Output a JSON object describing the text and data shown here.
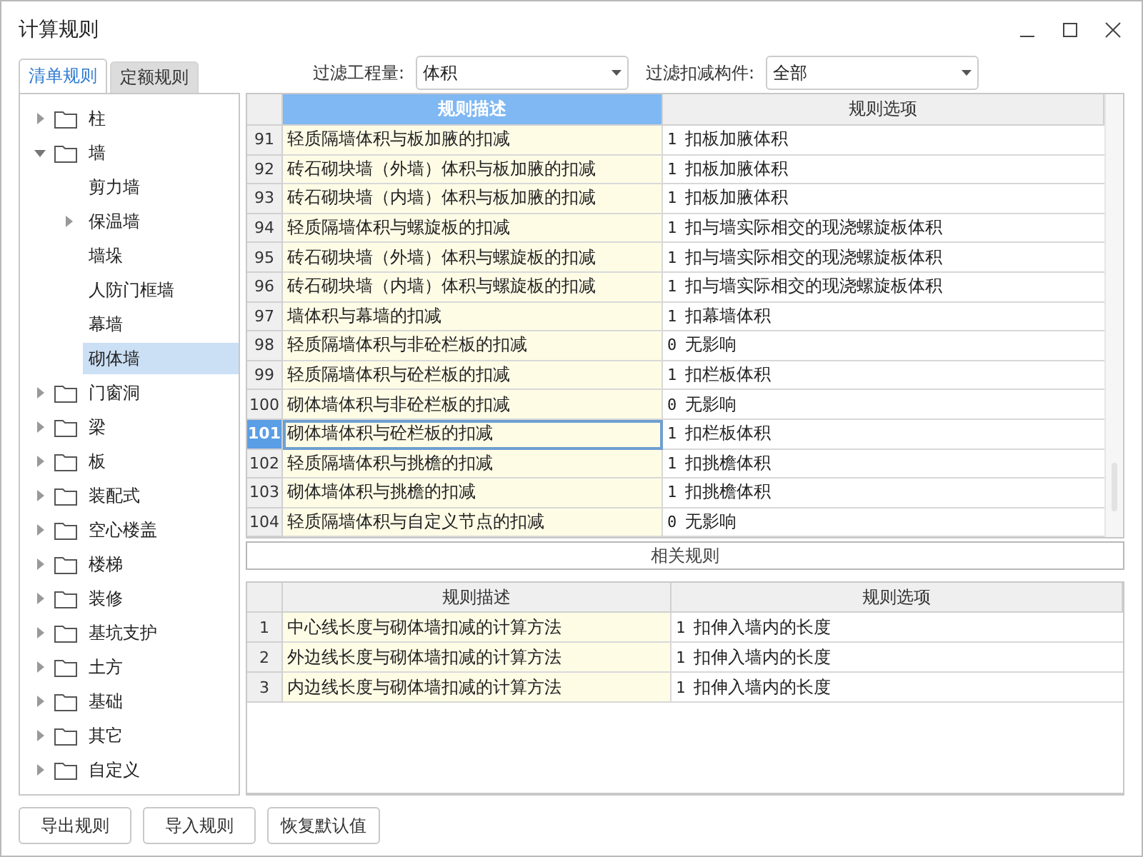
{
  "window": {
    "title": "计算规则"
  },
  "tabs": [
    {
      "label": "清单规则",
      "selected": true
    },
    {
      "label": "定额规则",
      "selected": false
    }
  ],
  "filters": [
    {
      "label": "过滤工程量:",
      "value": "体积"
    },
    {
      "label": "过滤扣减构件:",
      "value": "全部"
    }
  ],
  "tree": [
    {
      "label": "柱",
      "kind": "folder",
      "expanded": false
    },
    {
      "label": "墙",
      "kind": "folder",
      "expanded": true,
      "children": [
        {
          "label": "剪力墙",
          "selected": false
        },
        {
          "label": "保温墙",
          "expanded": false,
          "selected": false
        },
        {
          "label": "墙垛",
          "selected": false
        },
        {
          "label": "人防门框墙",
          "selected": false
        },
        {
          "label": "幕墙",
          "selected": false
        },
        {
          "label": "砌体墙",
          "selected": true
        }
      ]
    },
    {
      "label": "门窗洞",
      "kind": "folder",
      "expanded": false
    },
    {
      "label": "梁",
      "kind": "folder",
      "expanded": false
    },
    {
      "label": "板",
      "kind": "folder",
      "expanded": false
    },
    {
      "label": "装配式",
      "kind": "folder",
      "expanded": false
    },
    {
      "label": "空心楼盖",
      "kind": "folder",
      "expanded": false
    },
    {
      "label": "楼梯",
      "kind": "folder",
      "expanded": false
    },
    {
      "label": "装修",
      "kind": "folder",
      "expanded": false
    },
    {
      "label": "基坑支护",
      "kind": "folder",
      "expanded": false
    },
    {
      "label": "土方",
      "kind": "folder",
      "expanded": false
    },
    {
      "label": "基础",
      "kind": "folder",
      "expanded": false
    },
    {
      "label": "其它",
      "kind": "folder",
      "expanded": false
    },
    {
      "label": "自定义",
      "kind": "folder",
      "expanded": false
    }
  ],
  "rules_table": {
    "columns": [
      "规则描述",
      "规则选项"
    ],
    "rows": [
      {
        "number": "91",
        "description": "轻质隔墙体积与板加腋的扣减",
        "code": "1",
        "option": "扣板加腋体积",
        "selected": false
      },
      {
        "number": "92",
        "description": "砖石砌块墙（外墙）体积与板加腋的扣减",
        "code": "1",
        "option": "扣板加腋体积",
        "selected": false
      },
      {
        "number": "93",
        "description": "砖石砌块墙（内墙）体积与板加腋的扣减",
        "code": "1",
        "option": "扣板加腋体积",
        "selected": false
      },
      {
        "number": "94",
        "description": "轻质隔墙体积与螺旋板的扣减",
        "code": "1",
        "option": "扣与墙实际相交的现浇螺旋板体积",
        "selected": false
      },
      {
        "number": "95",
        "description": "砖石砌块墙（外墙）体积与螺旋板的扣减",
        "code": "1",
        "option": "扣与墙实际相交的现浇螺旋板体积",
        "selected": false
      },
      {
        "number": "96",
        "description": "砖石砌块墙（内墙）体积与螺旋板的扣减",
        "code": "1",
        "option": "扣与墙实际相交的现浇螺旋板体积",
        "selected": false
      },
      {
        "number": "97",
        "description": "墙体积与幕墙的扣减",
        "code": "1",
        "option": "扣幕墙体积",
        "selected": false
      },
      {
        "number": "98",
        "description": "轻质隔墙体积与非砼栏板的扣减",
        "code": "0",
        "option": "无影响",
        "selected": false
      },
      {
        "number": "99",
        "description": "轻质隔墙体积与砼栏板的扣减",
        "code": "1",
        "option": "扣栏板体积",
        "selected": false
      },
      {
        "number": "100",
        "description": "砌体墙体积与非砼栏板的扣减",
        "code": "0",
        "option": "无影响",
        "selected": false
      },
      {
        "number": "101",
        "description": "砌体墙体积与砼栏板的扣减",
        "code": "1",
        "option": "扣栏板体积",
        "selected": true
      },
      {
        "number": "102",
        "description": "轻质隔墙体积与挑檐的扣减",
        "code": "1",
        "option": "扣挑檐体积",
        "selected": false
      },
      {
        "number": "103",
        "description": "砌体墙体积与挑檐的扣减",
        "code": "1",
        "option": "扣挑檐体积",
        "selected": false
      },
      {
        "number": "104",
        "description": "轻质隔墙体积与自定义节点的扣减",
        "code": "0",
        "option": "无影响",
        "selected": false
      }
    ]
  },
  "related": {
    "title": "相关规则",
    "columns": [
      "规则描述",
      "规则选项"
    ],
    "rows": [
      {
        "number": "1",
        "description": "中心线长度与砌体墙扣减的计算方法",
        "code": "1",
        "option": "扣伸入墙内的长度"
      },
      {
        "number": "2",
        "description": "外边线长度与砌体墙扣减的计算方法",
        "code": "1",
        "option": "扣伸入墙内的长度"
      },
      {
        "number": "3",
        "description": "内边线长度与砌体墙扣减的计算方法",
        "code": "1",
        "option": "扣伸入墙内的长度"
      }
    ]
  },
  "buttons": [
    "导出规则",
    "导入规则",
    "恢复默认值"
  ]
}
